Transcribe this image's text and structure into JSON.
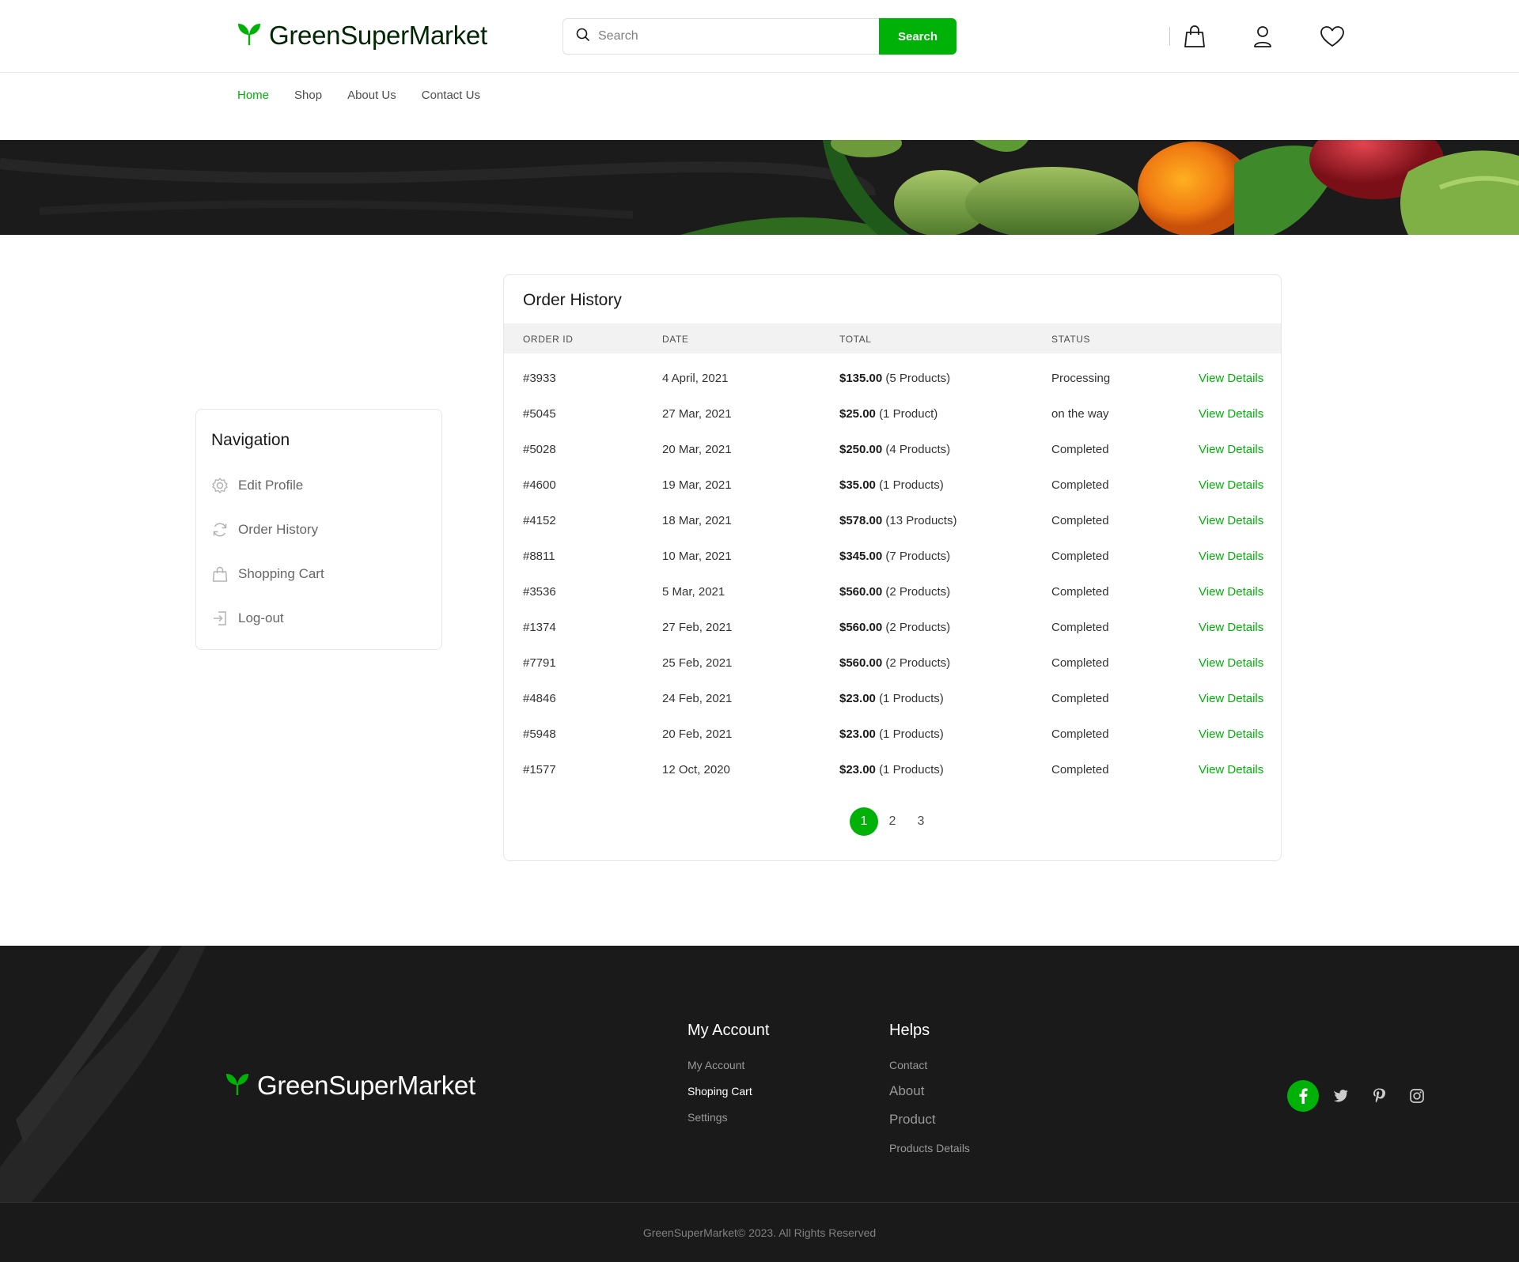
{
  "brand": {
    "name": "GreenSuperMarket",
    "accent": "#00b207"
  },
  "header": {
    "search_placeholder": "Search",
    "search_button": "Search",
    "icons": [
      "shopping-bag-icon",
      "user-icon",
      "heart-icon"
    ]
  },
  "nav": {
    "items": [
      {
        "label": "Home",
        "active": true
      },
      {
        "label": "Shop"
      },
      {
        "label": "About Us"
      },
      {
        "label": "Contact Us"
      }
    ]
  },
  "sidebar": {
    "title": "Navigation",
    "items": [
      {
        "label": "Edit Profile",
        "icon": "gear-icon"
      },
      {
        "label": "Order History",
        "icon": "refresh-icon"
      },
      {
        "label": "Shopping Cart",
        "icon": "shopping-bag-icon"
      },
      {
        "label": "Log-out",
        "icon": "logout-icon"
      }
    ]
  },
  "orders": {
    "title": "Order History",
    "columns": [
      "ORDER ID",
      "DATE",
      "TOTAL",
      "STATUS"
    ],
    "rows": [
      {
        "id": "#3933",
        "date": "4 April, 2021",
        "amount": "$135.00",
        "count": "(5 Products)",
        "status": "Processing",
        "action": "View Details"
      },
      {
        "id": "#5045",
        "date": "27 Mar, 2021",
        "amount": "$25.00",
        "count": "(1 Product)",
        "status": "on the way",
        "action": "View Details"
      },
      {
        "id": "#5028",
        "date": "20 Mar, 2021",
        "amount": "$250.00",
        "count": "(4 Products)",
        "status": "Completed",
        "action": "View Details"
      },
      {
        "id": "#4600",
        "date": "19 Mar, 2021",
        "amount": "$35.00",
        "count": "(1 Products)",
        "status": "Completed",
        "action": "View Details"
      },
      {
        "id": "#4152",
        "date": "18 Mar, 2021",
        "amount": "$578.00",
        "count": "(13 Products)",
        "status": "Completed",
        "action": "View Details"
      },
      {
        "id": "#8811",
        "date": "10 Mar, 2021",
        "amount": "$345.00",
        "count": "(7 Products)",
        "status": "Completed",
        "action": "View Details"
      },
      {
        "id": "#3536",
        "date": "5 Mar, 2021",
        "amount": "$560.00",
        "count": "(2 Products)",
        "status": "Completed",
        "action": "View Details"
      },
      {
        "id": "#1374",
        "date": "27 Feb, 2021",
        "amount": "$560.00",
        "count": "(2 Products)",
        "status": "Completed",
        "action": "View Details"
      },
      {
        "id": "#7791",
        "date": "25 Feb, 2021",
        "amount": "$560.00",
        "count": "(2 Products)",
        "status": "Completed",
        "action": "View Details"
      },
      {
        "id": "#4846",
        "date": "24 Feb, 2021",
        "amount": "$23.00",
        "count": "(1 Products)",
        "status": "Completed",
        "action": "View Details"
      },
      {
        "id": "#5948",
        "date": "20 Feb, 2021",
        "amount": "$23.00",
        "count": "(1 Products)",
        "status": "Completed",
        "action": "View Details"
      },
      {
        "id": "#1577",
        "date": "12 Oct, 2020",
        "amount": "$23.00",
        "count": "(1 Products)",
        "status": "Completed",
        "action": "View Details"
      }
    ],
    "pages": [
      "1",
      "2",
      "3"
    ],
    "current_page": "1"
  },
  "footer": {
    "account": {
      "title": "My Account",
      "links": [
        "My Account",
        "Shoping Cart",
        "Settings"
      ]
    },
    "helps": {
      "title": "Helps",
      "links": [
        "Contact",
        "About",
        "Product",
        "Products Details"
      ]
    },
    "social": [
      "facebook-icon",
      "twitter-icon",
      "pinterest-icon",
      "instagram-icon"
    ],
    "copyright": "GreenSuperMarket© 2023. All Rights Reserved"
  }
}
